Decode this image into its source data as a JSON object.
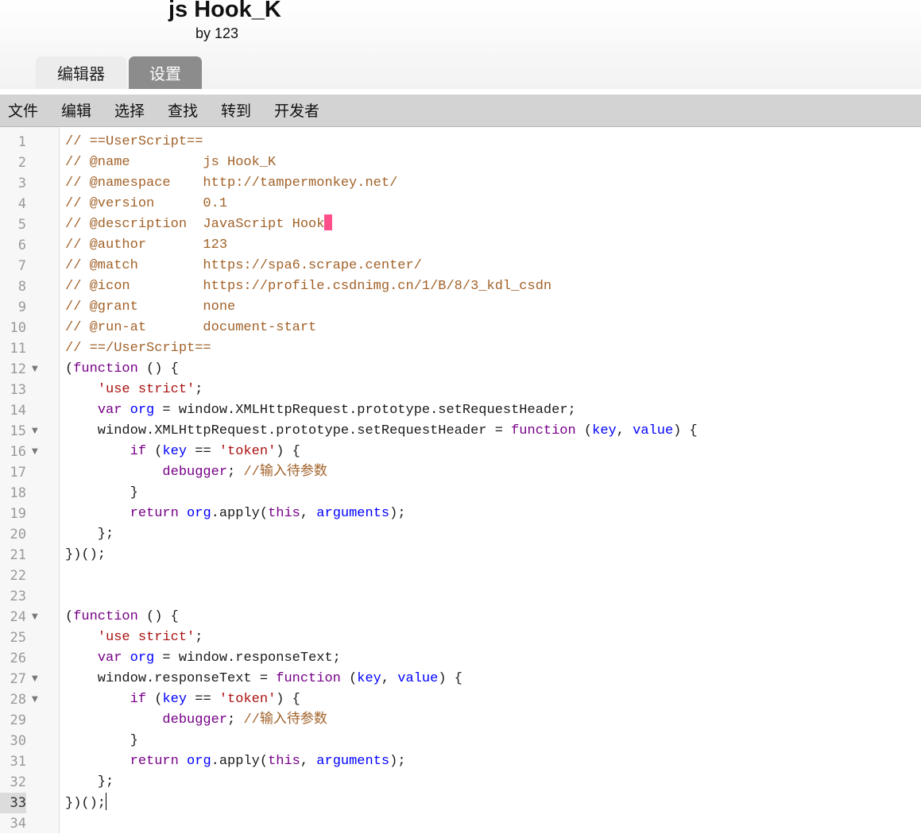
{
  "header": {
    "title": "js Hook_K",
    "author": "by 123"
  },
  "tabs": [
    {
      "label": "编辑器",
      "active": true
    },
    {
      "label": "设置",
      "active": false
    }
  ],
  "menu": [
    "文件",
    "编辑",
    "选择",
    "查找",
    "转到",
    "开发者"
  ],
  "editor": {
    "active_line": 33,
    "fold_lines": [
      12,
      15,
      16,
      24,
      27,
      28
    ],
    "lines": [
      "// ==UserScript==",
      "// @name         js Hook_K",
      "// @namespace    http://tampermonkey.net/",
      "// @version      0.1",
      "// @description  JavaScript Hook",
      "// @author       123",
      "// @match        https://spa6.scrape.center/",
      "// @icon         https://profile.csdnimg.cn/1/B/8/3_kdl_csdn",
      "// @grant        none",
      "// @run-at       document-start",
      "// ==/UserScript==",
      "(function () {",
      "    'use strict';",
      "    var org = window.XMLHttpRequest.prototype.setRequestHeader;",
      "    window.XMLHttpRequest.prototype.setRequestHeader = function (key, value) {",
      "        if (key == 'token') {",
      "            debugger; //输入待参数",
      "        }",
      "        return org.apply(this, arguments);",
      "    };",
      "})();",
      "",
      "",
      "(function () {",
      "    'use strict';",
      "    var org = window.responseText;",
      "    window.responseText = function (key, value) {",
      "        if (key == 'token') {",
      "            debugger; //输入待参数",
      "        }",
      "        return org.apply(this, arguments);",
      "    };",
      "})();",
      ""
    ]
  },
  "colors": {
    "comment": "#a2622a",
    "keyword": "#770088",
    "definition": "#0000ff",
    "variable": "#1a5aa8",
    "string": "#aa1111",
    "cursor_highlight": "#ff4f8b",
    "menubar_bg": "#d3d3d3",
    "tab_settings_bg": "#8c8c8c"
  }
}
